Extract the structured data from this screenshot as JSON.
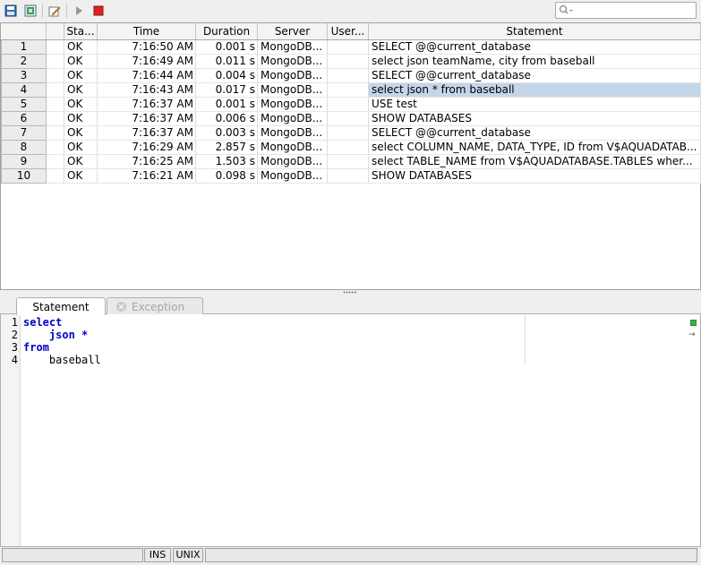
{
  "toolbar": {
    "search": {
      "placeholder": "",
      "value": ""
    },
    "icons": [
      "save-icon",
      "export-icon",
      "edit-icon",
      "run-icon",
      "stop-icon"
    ],
    "colors": {
      "stop": "#e02020",
      "run": "#808080"
    }
  },
  "grid": {
    "columns": [
      "",
      "Sta...",
      "Time",
      "Duration",
      "Server",
      "User...",
      "Statement"
    ],
    "rows": [
      {
        "num": "1",
        "status": "OK",
        "time": "7:16:50 AM",
        "duration": "0.001 s",
        "server": "MongoDB...",
        "user": "",
        "statement": "SELECT @@current_database"
      },
      {
        "num": "2",
        "status": "OK",
        "time": "7:16:49 AM",
        "duration": "0.011 s",
        "server": "MongoDB...",
        "user": "",
        "statement": "select json teamName, city from baseball"
      },
      {
        "num": "3",
        "status": "OK",
        "time": "7:16:44 AM",
        "duration": "0.004 s",
        "server": "MongoDB...",
        "user": "",
        "statement": "SELECT @@current_database"
      },
      {
        "num": "4",
        "status": "OK",
        "time": "7:16:43 AM",
        "duration": "0.017 s",
        "server": "MongoDB...",
        "user": "",
        "statement": "select json * from baseball"
      },
      {
        "num": "5",
        "status": "OK",
        "time": "7:16:37 AM",
        "duration": "0.001 s",
        "server": "MongoDB...",
        "user": "",
        "statement": "USE test"
      },
      {
        "num": "6",
        "status": "OK",
        "time": "7:16:37 AM",
        "duration": "0.006 s",
        "server": "MongoDB...",
        "user": "",
        "statement": "SHOW DATABASES"
      },
      {
        "num": "7",
        "status": "OK",
        "time": "7:16:37 AM",
        "duration": "0.003 s",
        "server": "MongoDB...",
        "user": "",
        "statement": "SELECT @@current_database"
      },
      {
        "num": "8",
        "status": "OK",
        "time": "7:16:29 AM",
        "duration": "2.857 s",
        "server": "MongoDB...",
        "user": "",
        "statement": "select COLUMN_NAME, DATA_TYPE, ID from V$AQUADATAB..."
      },
      {
        "num": "9",
        "status": "OK",
        "time": "7:16:25 AM",
        "duration": "1.503 s",
        "server": "MongoDB...",
        "user": "",
        "statement": "select TABLE_NAME from V$AQUADATABASE.TABLES wher..."
      },
      {
        "num": "10",
        "status": "OK",
        "time": "7:16:21 AM",
        "duration": "0.098 s",
        "server": "MongoDB...",
        "user": "",
        "statement": "SHOW DATABASES"
      }
    ],
    "selected_row": "4",
    "selection_color": "#c5d5ea"
  },
  "tabs": [
    {
      "label": "Statement",
      "active": true
    },
    {
      "label": "Exception",
      "active": false
    }
  ],
  "editor": {
    "line_numbers": [
      "1",
      "2",
      "3",
      "4"
    ],
    "lines": [
      {
        "kw": "select",
        "text": ""
      },
      {
        "kw": "",
        "text": "    json *"
      },
      {
        "kw": "from",
        "text": ""
      },
      {
        "kw": "",
        "text": "    baseball"
      }
    ],
    "keyword_color": "#0000c8"
  },
  "statusbar": {
    "mode": "INS",
    "line_ending": "UNIX"
  }
}
